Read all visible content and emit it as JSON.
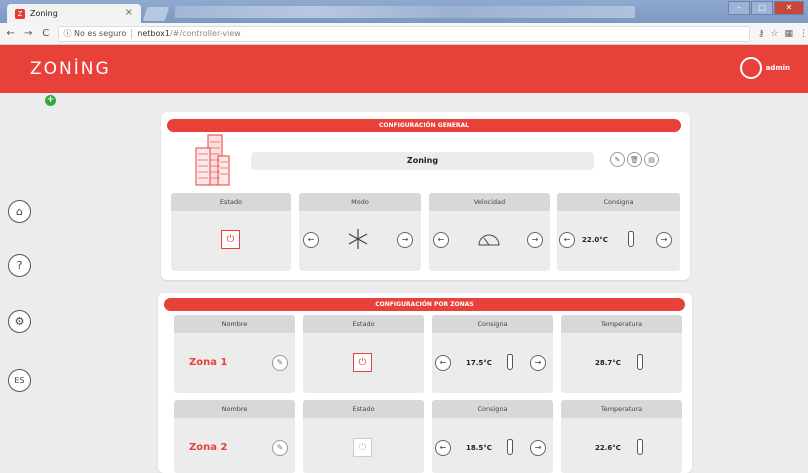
{
  "browser": {
    "tab_title": "Zoning",
    "tab_close": "×",
    "security": "ⓘ No es seguro",
    "url_host": "netbox1",
    "url_path": "/#/controller-view",
    "nav": {
      "back": "←",
      "forward": "→",
      "reload": "C"
    }
  },
  "app": {
    "logo": "ZONİNG",
    "user": "admin"
  },
  "sidebar": {
    "lang": "ES"
  },
  "general": {
    "title": "CONFIGURACIÓN GENERAL",
    "zone_name": "Zoning",
    "headers": {
      "estado": "Estado",
      "modo": "Modo",
      "velocidad": "Velocidad",
      "consigna": "Consigna"
    },
    "consigna_value": "22.0°C",
    "mode_icon": "snowflake-icon",
    "speed_icon": "fan-speed-icon"
  },
  "zones_section": {
    "title": "CONFIGURACIÓN POR ZONAS",
    "headers": {
      "nombre": "Nombre",
      "estado": "Estado",
      "consigna": "Consigna",
      "temperatura": "Temperatura"
    },
    "zones": [
      {
        "name": "Zona 1",
        "consigna": "17.5°C",
        "temperatura": "28.7°C",
        "power": "on"
      },
      {
        "name": "Zona 2",
        "consigna": "18.5°C",
        "temperatura": "22.6°C",
        "power": "off"
      }
    ]
  },
  "colors": {
    "accent": "#e8413a",
    "online": "#2eaa3a"
  }
}
